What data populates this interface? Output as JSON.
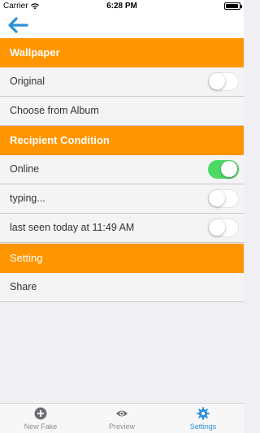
{
  "status_bar": {
    "carrier": "Carrier",
    "time": "6:28 PM"
  },
  "nav": {
    "back_icon": "back-arrow-icon",
    "accent_color": "#2b8fd8"
  },
  "sections": {
    "wallpaper": {
      "title": "Wallpaper"
    },
    "recipient": {
      "title": "Recipient Condition"
    },
    "setting": {
      "title": "Setting"
    }
  },
  "rows": {
    "original": {
      "label": "Original",
      "toggle_on": false
    },
    "choose_album": {
      "label": "Choose from Album"
    },
    "online": {
      "label": "Online",
      "toggle_on": true
    },
    "typing": {
      "label": "typing...",
      "toggle_on": false
    },
    "last_seen": {
      "label": "last seen today at 11:49 AM",
      "toggle_on": false
    },
    "share": {
      "label": "Share"
    }
  },
  "tab_bar": {
    "tabs": [
      {
        "label": "New Fake",
        "icon": "plus-circle-icon",
        "active": false
      },
      {
        "label": "Preview",
        "icon": "eye-icon",
        "active": false
      },
      {
        "label": "Settings",
        "icon": "gear-icon",
        "active": true
      }
    ]
  },
  "colors": {
    "header_orange": "#ff9500",
    "toggle_green": "#4cd964",
    "tab_active": "#2b8fd8",
    "tab_inactive": "#8e8e93"
  }
}
